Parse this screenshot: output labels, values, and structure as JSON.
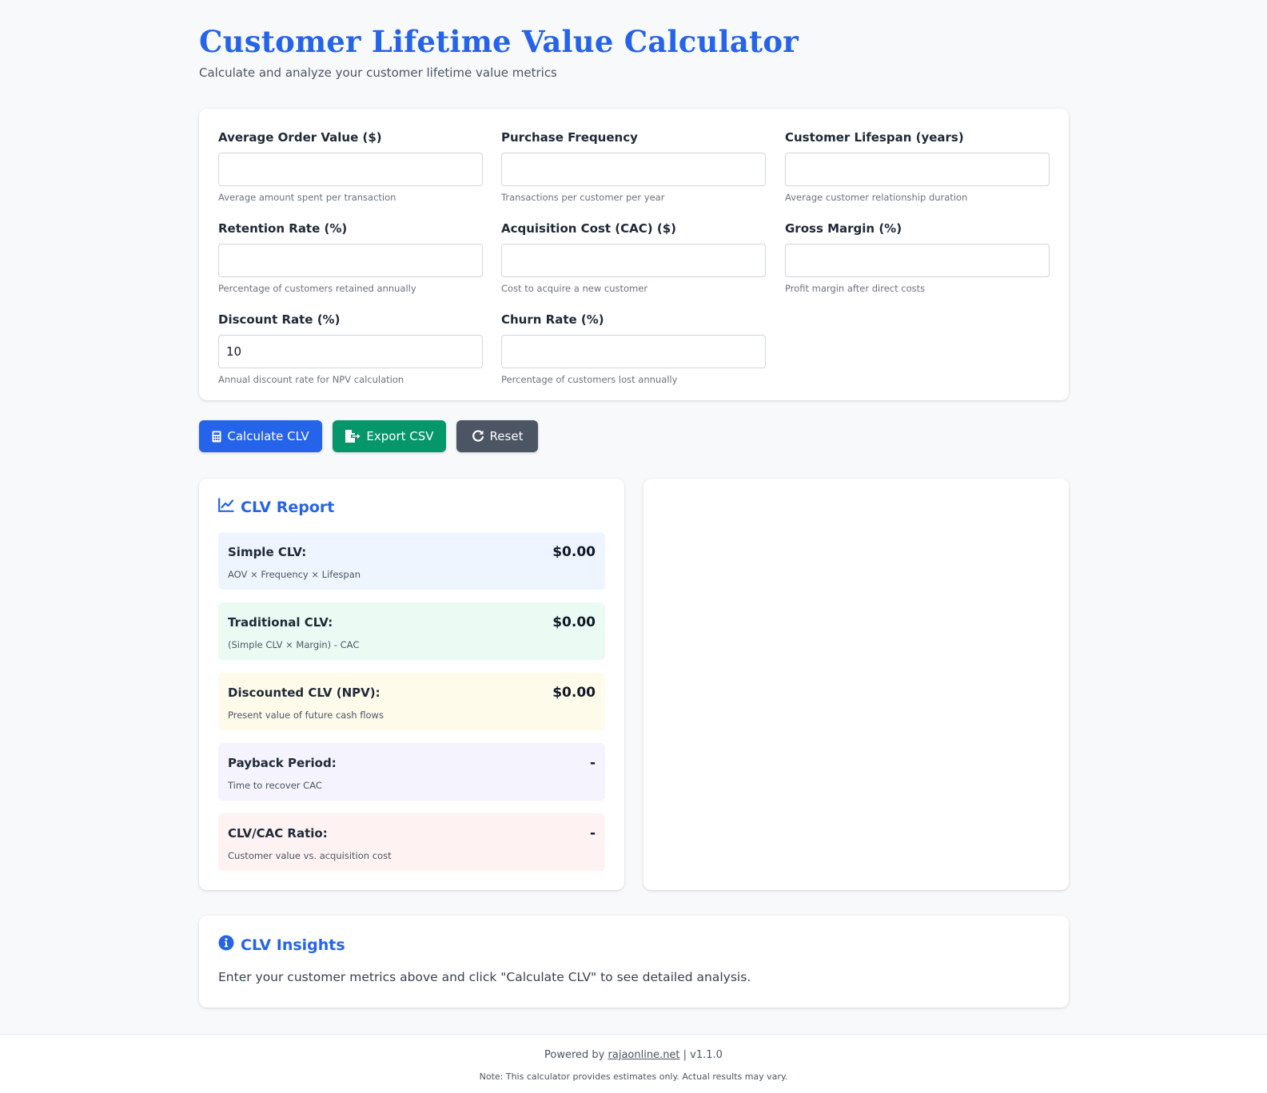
{
  "header": {
    "title": "Customer Lifetime Value Calculator",
    "subtitle": "Calculate and analyze your customer lifetime value metrics"
  },
  "form": {
    "fields": [
      {
        "label": "Average Order Value ($)",
        "value": "",
        "help": "Average amount spent per transaction"
      },
      {
        "label": "Purchase Frequency",
        "value": "",
        "help": "Transactions per customer per year"
      },
      {
        "label": "Customer Lifespan (years)",
        "value": "",
        "help": "Average customer relationship duration"
      },
      {
        "label": "Retention Rate (%)",
        "value": "",
        "help": "Percentage of customers retained annually"
      },
      {
        "label": "Acquisition Cost (CAC) ($)",
        "value": "",
        "help": "Cost to acquire a new customer"
      },
      {
        "label": "Gross Margin (%)",
        "value": "",
        "help": "Profit margin after direct costs"
      },
      {
        "label": "Discount Rate (%)",
        "value": "10",
        "help": "Annual discount rate for NPV calculation"
      },
      {
        "label": "Churn Rate (%)",
        "value": "",
        "help": "Percentage of customers lost annually"
      }
    ]
  },
  "actions": {
    "calculate_label": "Calculate CLV",
    "export_label": "Export CSV",
    "reset_label": "Reset"
  },
  "report": {
    "title": "CLV Report",
    "metrics": [
      {
        "label": "Simple CLV:",
        "value": "$0.00",
        "desc": "AOV × Frequency × Lifespan"
      },
      {
        "label": "Traditional CLV:",
        "value": "$0.00",
        "desc": "(Simple CLV × Margin) - CAC"
      },
      {
        "label": "Discounted CLV (NPV):",
        "value": "$0.00",
        "desc": "Present value of future cash flows"
      },
      {
        "label": "Payback Period:",
        "value": "-",
        "desc": "Time to recover CAC"
      },
      {
        "label": "CLV/CAC Ratio:",
        "value": "-",
        "desc": "Customer value vs. acquisition cost"
      }
    ]
  },
  "insights": {
    "title": "CLV Insights",
    "text": "Enter your customer metrics above and click \"Calculate CLV\" to see detailed analysis."
  },
  "footer": {
    "powered_prefix": "Powered by",
    "link_text": "rajaonline.net",
    "version": "| v1.1.0",
    "note": "Note: This calculator provides estimates only. Actual results may vary."
  },
  "colors": {
    "accent": "#2563eb",
    "export": "#059669",
    "reset": "#4b5563"
  },
  "icons": {
    "calculate": "calculator-icon",
    "export": "file-export-icon",
    "reset": "reset-icon",
    "report": "chart-line-icon",
    "insights": "info-circle-icon"
  }
}
